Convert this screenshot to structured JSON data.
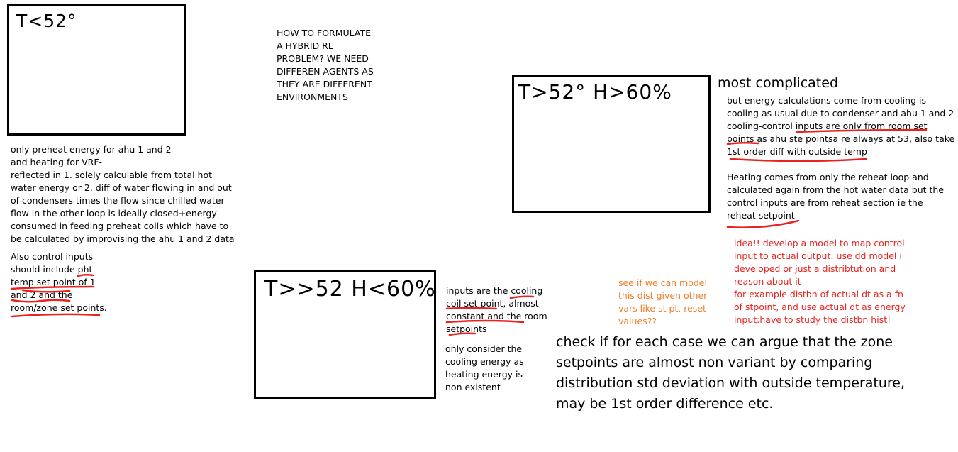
{
  "boxes": {
    "box1_label": "T<52°",
    "box2_label": "T>52°  H>60%",
    "box3_label": "T>>52  H<60%"
  },
  "notes": {
    "question": "HOW TO FORMULATE\nA HYBRID RL\nPROBLEM? WE NEED\nDIFFEREN AGENTS AS\nTHEY ARE DIFFERENT\nENVIRONMENTS",
    "preheat_note": "only preheat energy  for ahu 1 and 2\nand heating for VRF-\nreflected in 1. solely calculable from total hot\nwater energy or 2. diff of water flowing in  and out\nof condensers times the flow since chilled water\nflow in the other loop is ideally closed+energy\nconsumed in feeding preheat coils which have to\nbe calculated by improvising the ahu 1 and 2 data",
    "control_inputs_note": "Also control inputs\nshould include pht\ntemp set point of 1\nand 2 and the\nroom/zone set points.",
    "most_complicated": "most complicated",
    "cooling_energy_note": "but energy calculations come from cooling is\ncooling as usual due to condenser and ahu 1 and 2\ncooling-control inputs are only from room set\npoints as ahu ste pointsa re always at 53, also take\n1st order diff with outside temp",
    "heating_note": "Heating comes from only the reheat loop and\ncalculated again from the hot water data but the\ncontrol inputs are from reheat section ie the\nreheat setpoint",
    "idea_note": "idea!! develop a model to map control\ninput to actual output: use dd model i\ndeveloped or just a distribtution and\nreason about it\nfor example distbn of actual dt as a fn\nof stpoint, and use actual dt as energy\ninput:have to study the distbn hist!",
    "model_dist_note": "see if we can model\nthis dist given other\nvars like st pt, reset\nvalues??",
    "cooling_coil_note": "inputs are the cooling\ncoil set point, almost\nconstant and the room\nsetpoints",
    "cooling_only_note": "only consider the\ncooling energy as\nheating energy is\nnon existent",
    "check_note": "check if for each case we can argue that the zone\nsetpoints are almost non variant by comparing\ndistribution std deviation with outside temperature,\nmay be 1st order difference etc."
  },
  "colors": {
    "annotation_red": "#e8231f",
    "annotation_orange": "#f07d2a",
    "text_black": "#000000"
  }
}
